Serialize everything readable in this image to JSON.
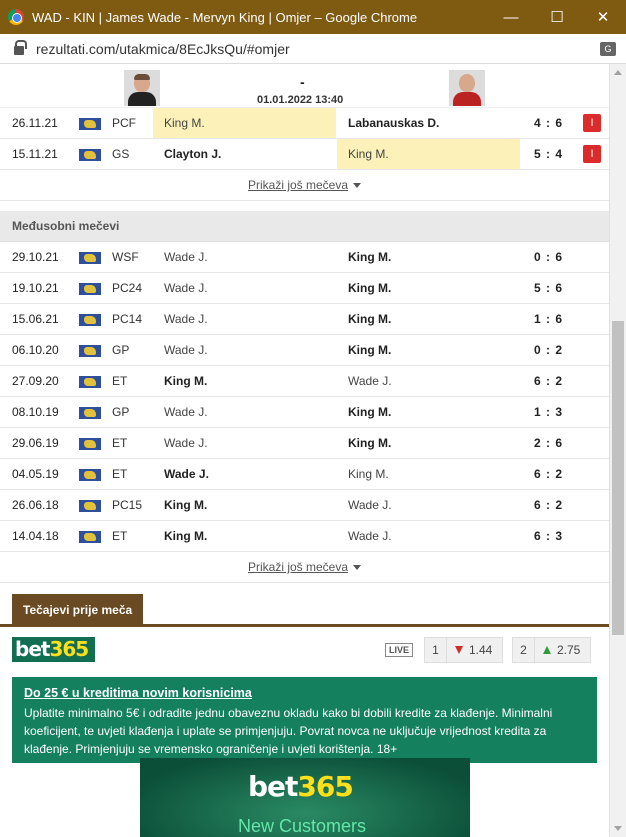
{
  "window": {
    "title": "WAD - KIN | James Wade - Mervyn King | Omjer – Google Chrome",
    "minimize": "—",
    "maximize": "☐",
    "close": "✕"
  },
  "address": {
    "url": "rezultati.com/utakmica/8EcJksQu/#omjer",
    "translate_icon": "G"
  },
  "match": {
    "score": "-",
    "datetime": "01.01.2022 13:40"
  },
  "last_matches": [
    {
      "date": "26.11.21",
      "comp": "PCF",
      "home": "King M.",
      "away": "Labanauskas D.",
      "score": "4 : 6",
      "result": "I",
      "winner": "away",
      "highlight": "home"
    },
    {
      "date": "15.11.21",
      "comp": "GS",
      "home": "Clayton J.",
      "away": "King M.",
      "score": "5 : 4",
      "result": "I",
      "winner": "home",
      "highlight": "away"
    }
  ],
  "show_more_label": "Prikaži još mečeva",
  "h2h": {
    "title": "Međusobni mečevi",
    "rows": [
      {
        "date": "29.10.21",
        "comp": "WSF",
        "home": "Wade J.",
        "away": "King M.",
        "score": "0 : 6",
        "winner": "away"
      },
      {
        "date": "19.10.21",
        "comp": "PC24",
        "home": "Wade J.",
        "away": "King M.",
        "score": "5 : 6",
        "winner": "away"
      },
      {
        "date": "15.06.21",
        "comp": "PC14",
        "home": "Wade J.",
        "away": "King M.",
        "score": "1 : 6",
        "winner": "away"
      },
      {
        "date": "06.10.20",
        "comp": "GP",
        "home": "Wade J.",
        "away": "King M.",
        "score": "0 : 2",
        "winner": "away"
      },
      {
        "date": "27.09.20",
        "comp": "ET",
        "home": "King M.",
        "away": "Wade J.",
        "score": "6 : 2",
        "winner": "home"
      },
      {
        "date": "08.10.19",
        "comp": "GP",
        "home": "Wade J.",
        "away": "King M.",
        "score": "1 : 3",
        "winner": "away"
      },
      {
        "date": "29.06.19",
        "comp": "ET",
        "home": "Wade J.",
        "away": "King M.",
        "score": "2 : 6",
        "winner": "away"
      },
      {
        "date": "04.05.19",
        "comp": "ET",
        "home": "Wade J.",
        "away": "King M.",
        "score": "6 : 2",
        "winner": "home"
      },
      {
        "date": "26.06.18",
        "comp": "PC15",
        "home": "King M.",
        "away": "Wade J.",
        "score": "6 : 2",
        "winner": "home"
      },
      {
        "date": "14.04.18",
        "comp": "ET",
        "home": "King M.",
        "away": "Wade J.",
        "score": "6 : 3",
        "winner": "home"
      }
    ]
  },
  "odds_tab_label": "Tečajevi prije meča",
  "bookmaker": {
    "logo_main": "bet",
    "logo_num": "365",
    "live_label": "LIVE",
    "odds": [
      {
        "label": "1",
        "value": "1.44",
        "trend": "down"
      },
      {
        "label": "2",
        "value": "2.75",
        "trend": "up"
      }
    ]
  },
  "promo": {
    "title": "Do 25 € u kreditima novim korisnicima",
    "text": "Uplatite minimalno 5€ i odradite jednu obaveznu okladu kako bi dobili kredite za klađenje. Minimalni koeficijent, te uvjeti klađenja i uplate se primjenjuju. Povrat novca ne uključuje vrijednost kredita za klađenje. Primjenjuju se vremensko ograničenje i uvjeti korištenja. 18+"
  },
  "banner": {
    "logo_main": "bet",
    "logo_num": "365",
    "subtitle": "New Customers"
  },
  "colors": {
    "title_bar": "#7f5b12",
    "highlight": "#fcf1b8",
    "loss_badge": "#dc2b2b",
    "bet365_green": "#126e51",
    "odds_tab": "#6a4a22"
  }
}
